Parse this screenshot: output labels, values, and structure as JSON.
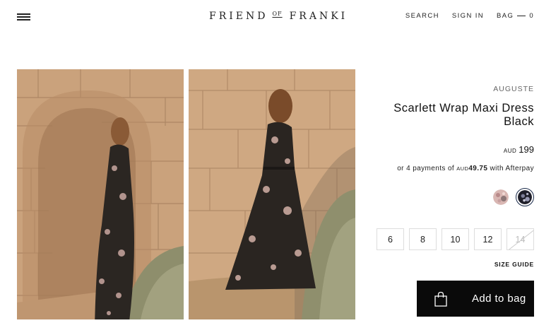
{
  "header": {
    "menu_icon": "hamburger-menu-icon",
    "logo": {
      "left": "FRIEND",
      "middle": "OF",
      "right": "FRANKI"
    },
    "nav": {
      "search": "SEARCH",
      "sign_in": "SIGN IN",
      "bag": "BAG",
      "bag_count": "0"
    }
  },
  "gallery": {
    "images": [
      {
        "name": "model-leaning-stone-arch"
      },
      {
        "name": "model-back-view-stone-wall"
      }
    ]
  },
  "product": {
    "brand": "AUGUSTE",
    "title_line1": "Scarlett Wrap Maxi Dress",
    "title_line2": "Black",
    "price_currency": "AUD",
    "price_amount": "199",
    "afterpay_prefix": "or 4 payments of",
    "afterpay_currency": "AUD",
    "afterpay_amount": "49.75",
    "afterpay_suffix": "with Afterpay"
  },
  "swatches": [
    {
      "name": "floral-pink",
      "selected": false
    },
    {
      "name": "black",
      "selected": true
    }
  ],
  "sizes": [
    {
      "label": "6",
      "available": true
    },
    {
      "label": "8",
      "available": true
    },
    {
      "label": "10",
      "available": true
    },
    {
      "label": "12",
      "available": true
    },
    {
      "label": "14",
      "available": false
    }
  ],
  "size_guide": "SIZE GUIDE",
  "cta": {
    "label": "Add to bag",
    "icon": "shopping-bag-icon"
  },
  "colors": {
    "cta_bg": "#0a0a0a",
    "stone": "#c9a07a",
    "text": "#111111"
  }
}
